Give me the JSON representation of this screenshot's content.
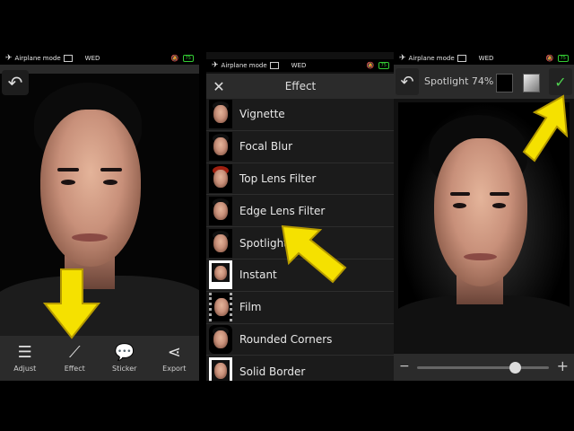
{
  "status": {
    "airplane_label": "Airplane mode",
    "day": "WED",
    "battery": "75"
  },
  "editor": {
    "toolbar": [
      {
        "label": "Adjust",
        "icon": "sliders-icon"
      },
      {
        "label": "Effect",
        "icon": "magic-wand-icon"
      },
      {
        "label": "Sticker",
        "icon": "speech-bubble-icon"
      },
      {
        "label": "Export",
        "icon": "share-icon"
      }
    ]
  },
  "effect_menu": {
    "title": "Effect",
    "items": [
      {
        "label": "Vignette",
        "thumb": "plain"
      },
      {
        "label": "Focal Blur",
        "thumb": "plain"
      },
      {
        "label": "Top Lens Filter",
        "thumb": "red"
      },
      {
        "label": "Edge Lens Filter",
        "thumb": "plain"
      },
      {
        "label": "Spotlight",
        "thumb": "plain"
      },
      {
        "label": "Instant",
        "thumb": "polaroid"
      },
      {
        "label": "Film",
        "thumb": "film"
      },
      {
        "label": "Rounded Corners",
        "thumb": "rounded"
      },
      {
        "label": "Solid Border",
        "thumb": "border"
      }
    ]
  },
  "spotlight": {
    "filter_label": "Spotlight 74%",
    "slider_value": 0.74
  },
  "colors": {
    "accent_arrow": "#f5e100",
    "confirm_green": "#4fd04f"
  }
}
